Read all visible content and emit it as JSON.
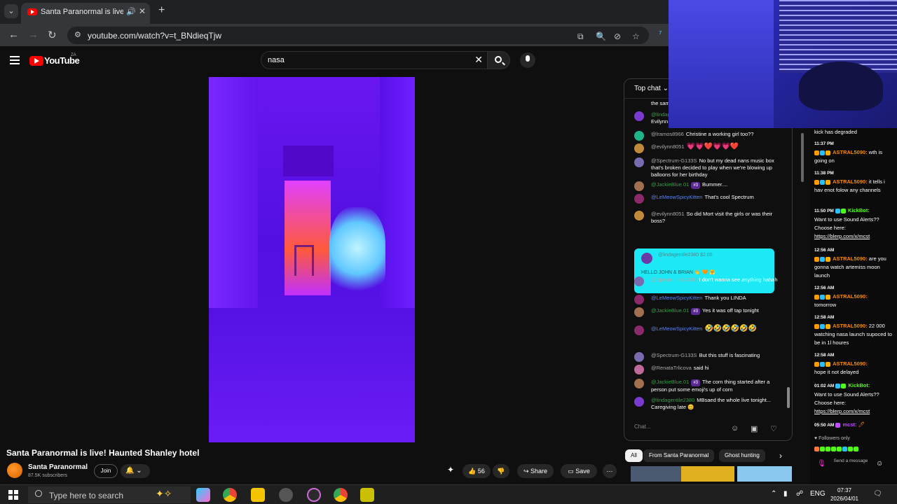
{
  "browser": {
    "tab_title": "Santa Paranormal is live! Haunted",
    "url": "youtube.com/watch?v=t_BNdieqTjw"
  },
  "youtube": {
    "logo_text": "YouTube",
    "region": "ZA",
    "search_query": "nasa"
  },
  "video": {
    "title": "Santa Paranormal is live! Haunted Shanley hotel",
    "channel": "Santa Paranormal",
    "subscribers": "87.5K subscribers",
    "join_label": "Join",
    "likes": "56",
    "share_label": "Share",
    "save_label": "Save"
  },
  "chat": {
    "header": "Top chat",
    "input_placeholder": "Chat...",
    "messages": [
      {
        "author": "",
        "text": "the sam",
        "color": "#aaa"
      },
      {
        "author": "@lindag",
        "text": "Evilynn",
        "color": "#2ba640"
      },
      {
        "author": "@lramos8966",
        "text": "Christine a working girl too??",
        "color": "#aaa"
      },
      {
        "author": "@evilynn8051",
        "text": "💗💗❤️💗💗❤️",
        "color": "#aaa"
      },
      {
        "author": "@Spectrum-G133S",
        "text": "No but my dead nans music box that's broken decided to play when we're blowing up balloons for her birthday",
        "color": "#aaa"
      },
      {
        "author": "@JackieBlue.01",
        "badge": "#3",
        "text": "Bummer....",
        "color": "#2ba640"
      },
      {
        "author": "@LeMeowSpicyKitten",
        "text": "That's cool Spectrum",
        "color": "#5e84f1"
      },
      {
        "author": "@evilynn8051",
        "text": "So did Mort visit the girls or was their boss?",
        "color": "#aaa"
      },
      {
        "author": "@Spectrum-G133S",
        "text": "I don't wanna see anything hahah",
        "color": "#aaa"
      },
      {
        "author": "@LeMeowSpicyKitten",
        "text": "Thank you LINDA",
        "color": "#5e84f1"
      },
      {
        "author": "@JackieBlue.01",
        "badge": "#3",
        "text": "Yes it was off tap tonight",
        "color": "#2ba640"
      },
      {
        "author": "@LeMeowSpicyKitten",
        "text": "🤣🤣🤣🤣🤣🤣",
        "color": "#5e84f1"
      },
      {
        "author": "@Spectrum-G133S",
        "text": "But this stuff is fascinating",
        "color": "#aaa"
      },
      {
        "author": "@RenataTrlicova",
        "text": "said hi",
        "color": "#aaa"
      },
      {
        "author": "@JackieBlue.01",
        "badge": "#3",
        "text": "The corn thing started after a person put some emoji's up of corn",
        "color": "#2ba640"
      },
      {
        "author": "@lindagentile2380",
        "text": "MBsaed the whole live tonight... Caregiving late 😊",
        "color": "#2ba640"
      }
    ],
    "superchat": {
      "author": "@lindagentile2380",
      "amount": "$2.00",
      "text": "HELLO JOHN & BRIAN 👋 🧡 🤗"
    }
  },
  "chips": [
    "All",
    "From Santa Paranormal",
    "Ghost hunting"
  ],
  "kick": {
    "lines": [
      {
        "time": "",
        "author": "",
        "text": "kick has degraded"
      },
      {
        "time": "11:37 PM",
        "author": "ASTRAL5090:",
        "text": "wth is going on"
      },
      {
        "time": "11:38 PM",
        "author": "ASTRAL5090:",
        "text": "it tells i hav enot folow any channels"
      },
      {
        "time": "11:50 PM",
        "author": "KickBot:",
        "text": "Want to use Sound Alerts?? Choose here:",
        "link": "https://blerp.com/x/mcst"
      },
      {
        "time": "12:56 AM",
        "author": "ASTRAL5090:",
        "text": "are you gonna watch artemiss moon launch"
      },
      {
        "time": "12:56 AM",
        "author": "ASTRAL5090:",
        "text": "tomorrow"
      },
      {
        "time": "12:58 AM",
        "author": "ASTRAL5090:",
        "text": "22 000 watching nasa launch supoced to be in 1l houres"
      },
      {
        "time": "12:58 AM",
        "author": "ASTRAL5090:",
        "text": "hope it not delayed"
      },
      {
        "time": "01:02 AM",
        "author": "KickBot:",
        "text": "Want to use Sound Alerts?? Choose here:",
        "link": "https://blerp.com/x/mcst"
      },
      {
        "time": "05:50 AM",
        "author": "mcst:",
        "text": ""
      }
    ],
    "followers_only": "Followers only",
    "send_message": "Send a message"
  },
  "taskbar": {
    "search_placeholder": "Type here to search",
    "lang": "ENG",
    "time": "07:37",
    "date": "2026/04/01"
  }
}
